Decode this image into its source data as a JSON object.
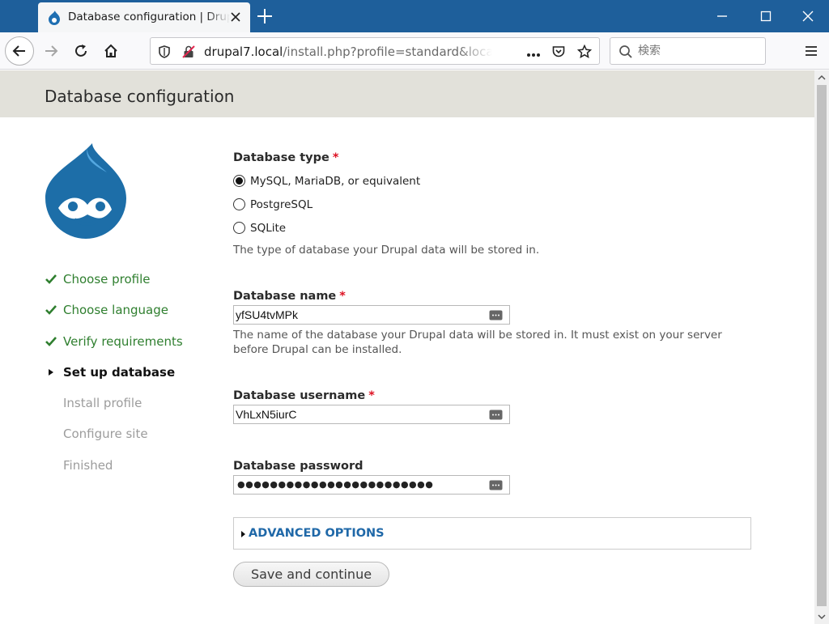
{
  "browser": {
    "tab_title": "Database configuration | Drupal",
    "url_host": "drupal7.local",
    "url_path": "/install.php?profile=standard&locale=ja",
    "search_placeholder": "検索",
    "colors": {
      "titlebar": "#1e5f9b",
      "tab": "#f5f6f7",
      "navbar": "#f9f9fb"
    }
  },
  "page": {
    "title": "Database configuration",
    "colors": {
      "header_bg": "#e2e1da",
      "step_done": "#2f7f2f",
      "link": "#1f68a8",
      "required": "#dd1122"
    }
  },
  "steps": [
    {
      "label": "Choose profile",
      "state": "done"
    },
    {
      "label": "Choose language",
      "state": "done"
    },
    {
      "label": "Verify requirements",
      "state": "done"
    },
    {
      "label": "Set up database",
      "state": "active"
    },
    {
      "label": "Install profile",
      "state": "pending"
    },
    {
      "label": "Configure site",
      "state": "pending"
    },
    {
      "label": "Finished",
      "state": "pending"
    }
  ],
  "form": {
    "db_type": {
      "label": "Database type",
      "required_mark": "*",
      "options": [
        "MySQL, MariaDB, or equivalent",
        "PostgreSQL",
        "SQLite"
      ],
      "selected": 0,
      "description": "The type of database your Drupal data will be stored in."
    },
    "db_name": {
      "label": "Database name",
      "required_mark": "*",
      "value": "yfSU4tvMPk",
      "description": "The name of the database your Drupal data will be stored in. It must exist on your server before Drupal can be installed."
    },
    "db_username": {
      "label": "Database username",
      "required_mark": "*",
      "value": "VhLxN5iurC"
    },
    "db_password": {
      "label": "Database password",
      "masked_value": "●●●●●●●●●●●●●●●●●●●●●●●●"
    },
    "advanced_label": "ADVANCED OPTIONS",
    "submit_label": "Save and continue"
  }
}
